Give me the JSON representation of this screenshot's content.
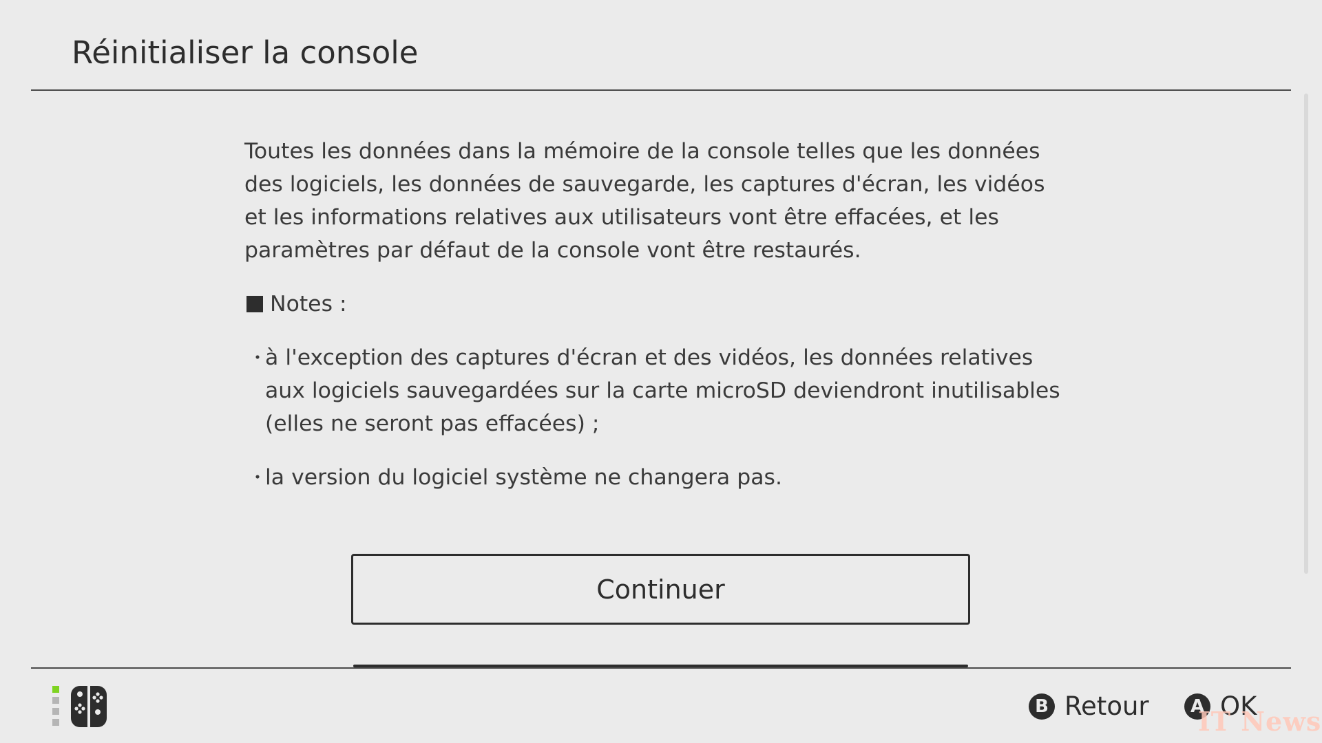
{
  "header": {
    "title": "Réinitialiser la console"
  },
  "body": {
    "paragraph": "Toutes les données dans la mémoire de la console telles que les données des logiciels, les données de sauvegarde, les captures d'écran, les vidéos et les informations relatives aux utilisateurs vont être effacées, et les paramètres par défaut de la console vont être restaurés.",
    "notes_heading": "Notes :",
    "bullet_glyph": "・",
    "notes": [
      "à l'exception des captures d'écran et des vidéos, les données relatives aux logiciels sauvegardées sur la carte microSD deviendront inutilisables (elles ne seront pas effacées) ;",
      "la version du logiciel système ne changera pas."
    ]
  },
  "continue_button": {
    "label": "Continuer"
  },
  "footer": {
    "controller_icon": "joy-con-controllers-icon",
    "back": {
      "key": "B",
      "label": "Retour"
    },
    "ok": {
      "key": "A",
      "label": "OK"
    }
  },
  "watermark": {
    "text": "IT News"
  },
  "colors": {
    "background": "#ebebeb",
    "text": "#2d2d2d",
    "player_indicator": "#7ed321"
  }
}
